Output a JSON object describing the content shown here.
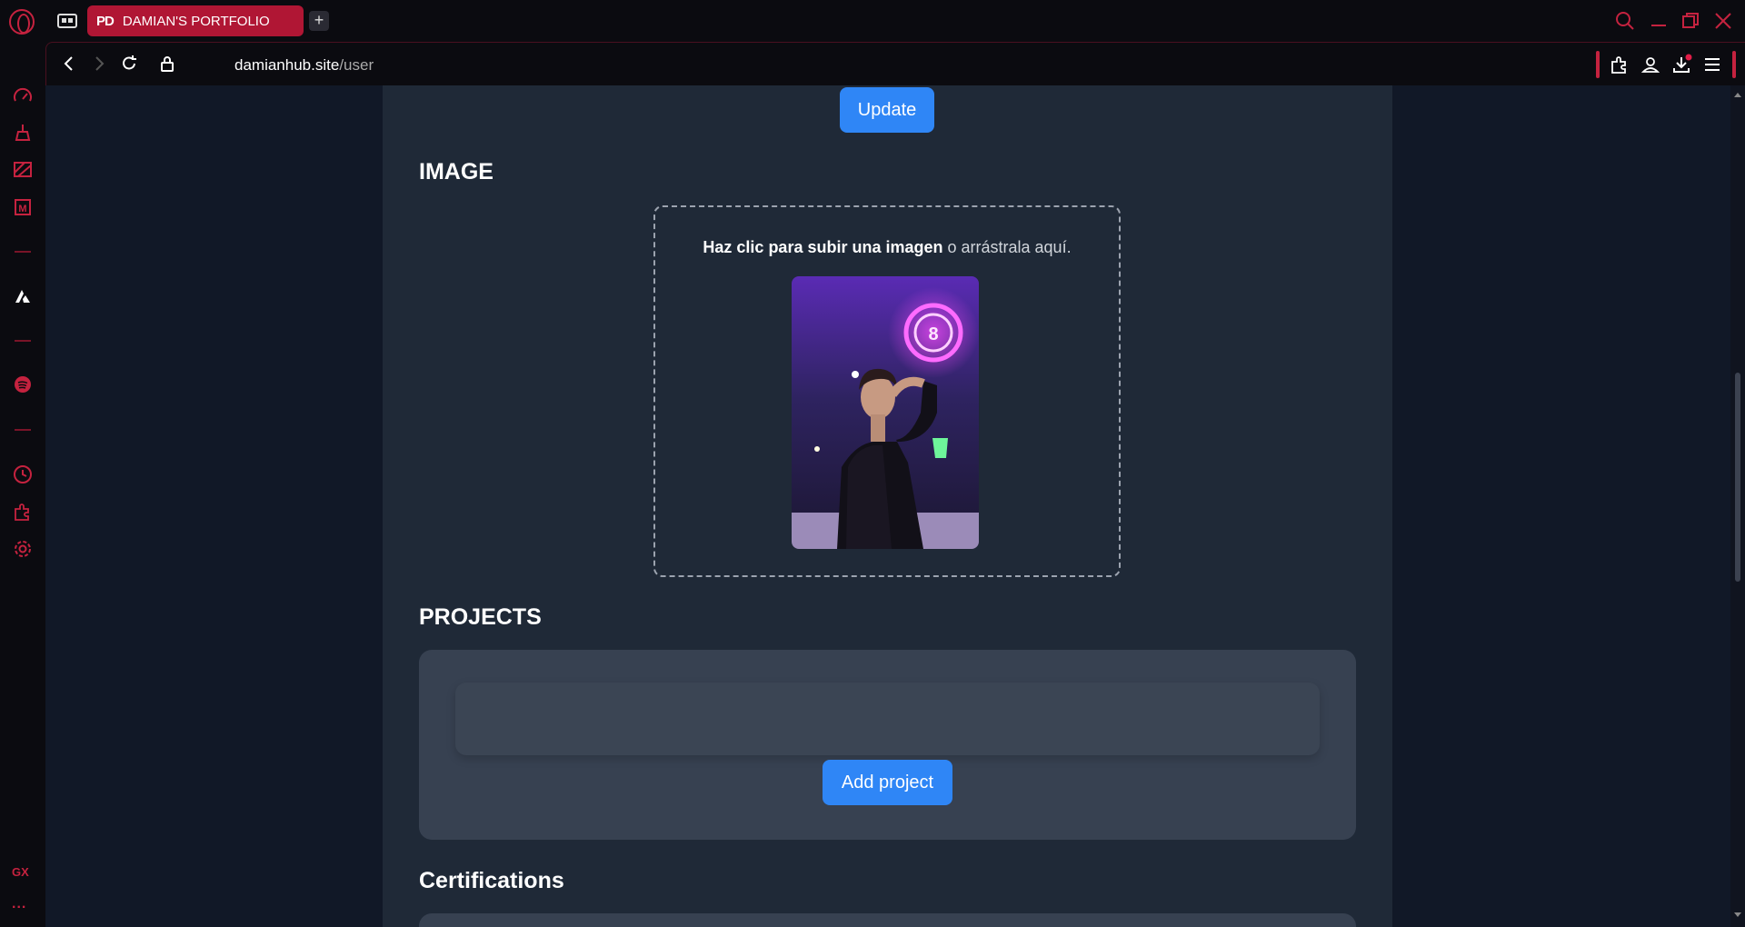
{
  "browser": {
    "tab_title": "DAMIAN'S PORTFOLIO",
    "tab_favicon_text": "PD",
    "url_host": "damianhub.site",
    "url_path": "/user",
    "brand_color": "#c5223f",
    "sidebar_label": "GX",
    "sidebar_more": "..."
  },
  "page": {
    "update_button": "Update",
    "image_section_title": "IMAGE",
    "dropzone_bold": "Haz clic para subir una imagen",
    "dropzone_rest": " o arrástrala aquí.",
    "projects_title": "PROJECTS",
    "add_project_button": "Add project",
    "certifications_title": "Certifications",
    "accent_color": "#2f86f6"
  }
}
